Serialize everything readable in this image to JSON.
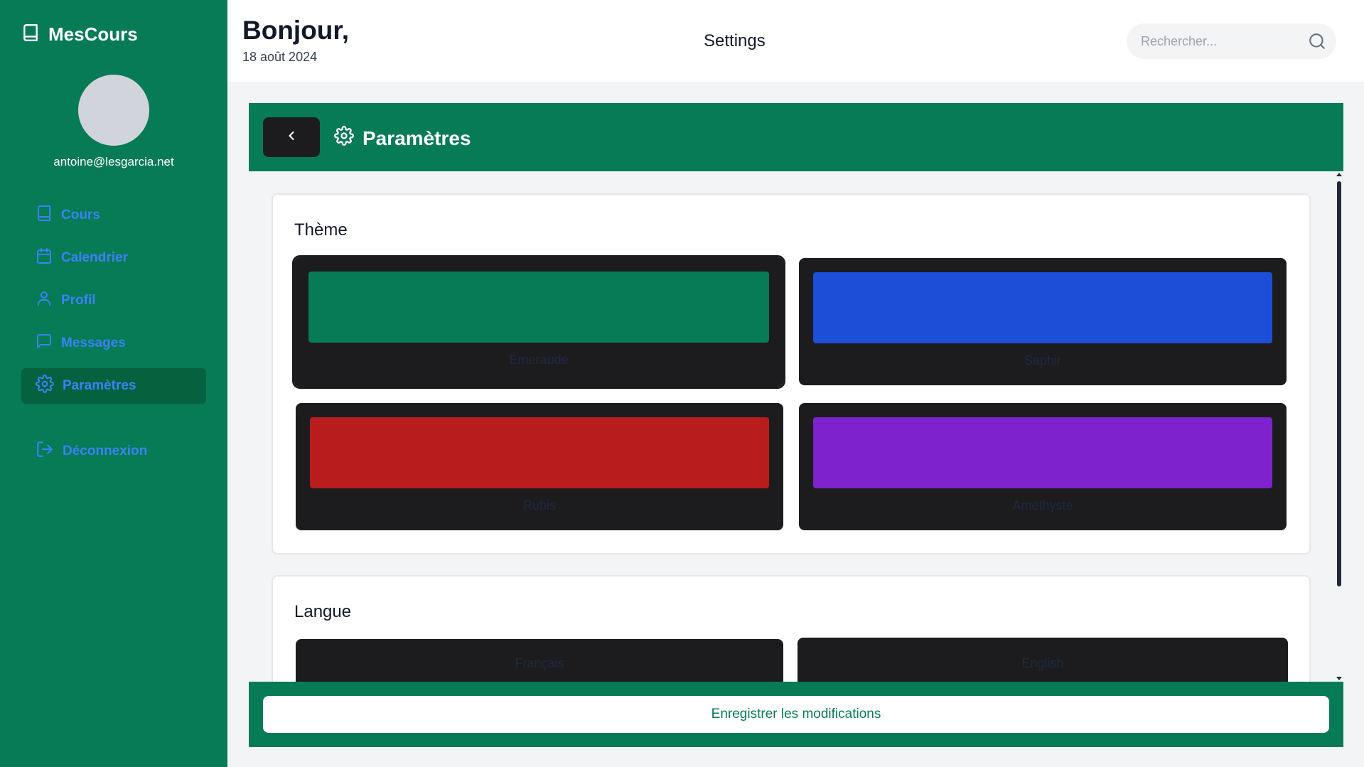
{
  "sidebar": {
    "brand": "MesCours",
    "email": "antoine@lesgarcia.net",
    "items": [
      {
        "label": "Cours",
        "icon": "book-icon"
      },
      {
        "label": "Calendrier",
        "icon": "calendar-icon"
      },
      {
        "label": "Profil",
        "icon": "user-icon"
      },
      {
        "label": "Messages",
        "icon": "message-icon"
      },
      {
        "label": "Paramètres",
        "icon": "gear-icon",
        "active": true
      }
    ],
    "logout": "Déconnexion"
  },
  "header": {
    "greeting": "Bonjour,",
    "date": "18 août 2024",
    "title": "Settings",
    "search_placeholder": "Rechercher..."
  },
  "panel": {
    "title": "Paramètres"
  },
  "theme": {
    "heading": "Thème",
    "options": [
      {
        "name": "Émeraude",
        "color": "#077a56",
        "selected": true
      },
      {
        "name": "Saphir",
        "color": "#1d4ed8"
      },
      {
        "name": "Rubis",
        "color": "#b91c1c"
      },
      {
        "name": "Améthyste",
        "color": "#7e22ce"
      }
    ]
  },
  "language": {
    "heading": "Langue",
    "options": [
      {
        "name": "Français"
      },
      {
        "name": "English"
      }
    ]
  },
  "footer": {
    "save_label": "Enregistrer les modifications"
  },
  "colors": {
    "primary": "#077a56",
    "dark": "#1c1c1e",
    "nav_text": "#3b82f6"
  }
}
